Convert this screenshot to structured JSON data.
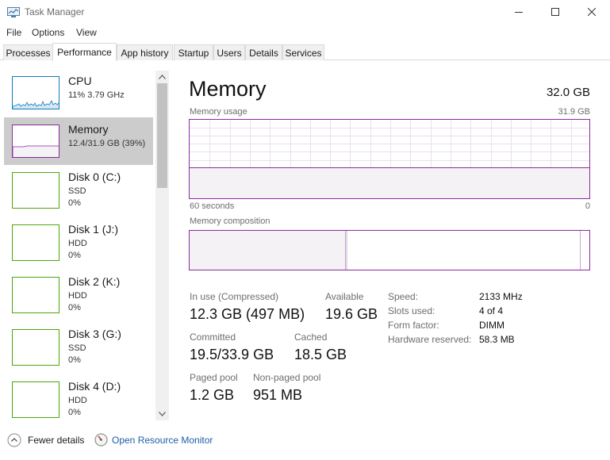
{
  "window": {
    "title": "Task Manager",
    "minimize_icon": "minimize-icon",
    "maximize_icon": "maximize-icon",
    "close_icon": "close-icon"
  },
  "menu": [
    "File",
    "Options",
    "View"
  ],
  "tabs": [
    {
      "label": "Processes",
      "active": false
    },
    {
      "label": "Performance",
      "active": true
    },
    {
      "label": "App history",
      "active": false
    },
    {
      "label": "Startup",
      "active": false
    },
    {
      "label": "Users",
      "active": false
    },
    {
      "label": "Details",
      "active": false
    },
    {
      "label": "Services",
      "active": false
    }
  ],
  "sidebar": {
    "items": [
      {
        "title": "CPU",
        "line1": "11%  3.79 GHz",
        "line2": "",
        "selected": false,
        "color": "#117dbb"
      },
      {
        "title": "Memory",
        "line1": "12.4/31.9 GB (39%)",
        "line2": "",
        "selected": true,
        "color": "#8b2b9b"
      },
      {
        "title": "Disk 0 (C:)",
        "line1": "SSD",
        "line2": "0%",
        "selected": false,
        "color": "#4da60c"
      },
      {
        "title": "Disk 1 (J:)",
        "line1": "HDD",
        "line2": "0%",
        "selected": false,
        "color": "#4da60c"
      },
      {
        "title": "Disk 2 (K:)",
        "line1": "HDD",
        "line2": "0%",
        "selected": false,
        "color": "#4da60c"
      },
      {
        "title": "Disk 3 (G:)",
        "line1": "SSD",
        "line2": "0%",
        "selected": false,
        "color": "#4da60c"
      },
      {
        "title": "Disk 4 (D:)",
        "line1": "HDD",
        "line2": "0%",
        "selected": false,
        "color": "#4da60c"
      }
    ]
  },
  "memory": {
    "title": "Memory",
    "total": "32.0 GB",
    "usage_label": "Memory usage",
    "usage_max": "31.9 GB",
    "usage_fraction": 0.39,
    "time_left": "60 seconds",
    "time_right": "0",
    "composition_label": "Memory composition",
    "composition": {
      "in_use_fraction": 0.39,
      "modified_fraction": 0.004,
      "standby_fraction": 0.58
    },
    "stats": {
      "in_use_label": "In use (Compressed)",
      "in_use_value": "12.3 GB (497 MB)",
      "available_label": "Available",
      "available_value": "19.6 GB",
      "committed_label": "Committed",
      "committed_value": "19.5/33.9 GB",
      "cached_label": "Cached",
      "cached_value": "18.5 GB",
      "paged_label": "Paged pool",
      "paged_value": "1.2 GB",
      "nonpaged_label": "Non-paged pool",
      "nonpaged_value": "951 MB"
    },
    "details": [
      {
        "key": "Speed:",
        "value": "2133 MHz"
      },
      {
        "key": "Slots used:",
        "value": "4 of 4"
      },
      {
        "key": "Form factor:",
        "value": "DIMM"
      },
      {
        "key": "Hardware reserved:",
        "value": "58.3 MB"
      }
    ]
  },
  "footer": {
    "fewer_details": "Fewer details",
    "open_monitor": "Open Resource Monitor"
  },
  "colors": {
    "memory": "#8b2b9b",
    "cpu": "#117dbb",
    "disk": "#4da60c",
    "link": "#1c5fa8"
  }
}
